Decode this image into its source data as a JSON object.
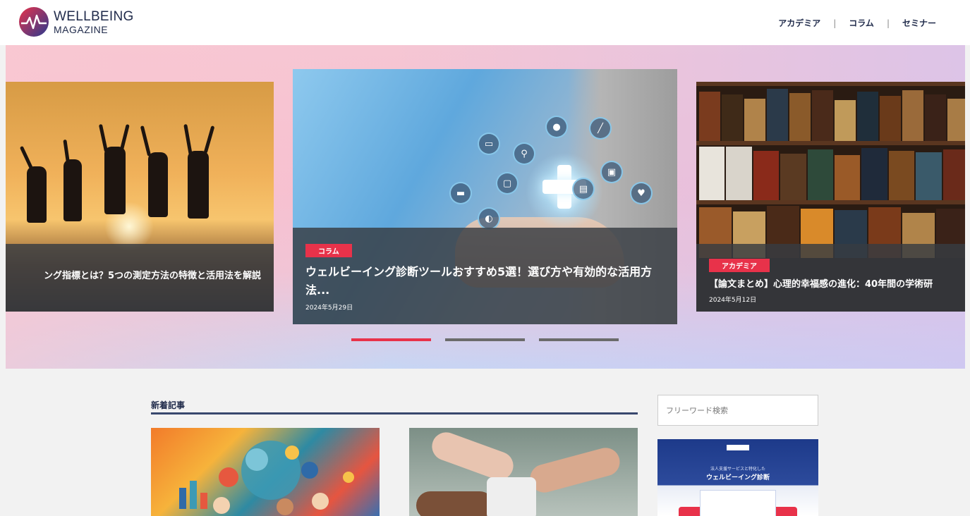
{
  "header": {
    "logo": {
      "line1": "WELLBEING",
      "line2": "MAGAZINE"
    },
    "nav": [
      {
        "label": "アカデミア"
      },
      {
        "label": "コラム"
      },
      {
        "label": "セミナー"
      }
    ],
    "separator": "|"
  },
  "hero": {
    "slides": [
      {
        "position": "left",
        "title": "ング指標とは？5つの測定方法の特徴と活用法を解説"
      },
      {
        "position": "center",
        "tag": "コラム",
        "title": "ウェルビーイング診断ツールおすすめ5選！選び方や有効的な活用方法...",
        "date": "2024年5月29日"
      },
      {
        "position": "right",
        "tag": "アカデミア",
        "title": "【論文まとめ】心理的幸福感の進化：40年間の学術研",
        "date": "2024年5月12日"
      }
    ],
    "pagination": {
      "count": 3,
      "active_index": 0
    }
  },
  "main": {
    "section_title": "新着記事"
  },
  "sidebar": {
    "search_placeholder": "フリーワード検索",
    "banner": {
      "subtitle": "法人支援サービスと特化した",
      "title": "ウェルビーイング診断"
    }
  },
  "colors": {
    "accent": "#e8324a",
    "navy": "#1f2a4a"
  }
}
